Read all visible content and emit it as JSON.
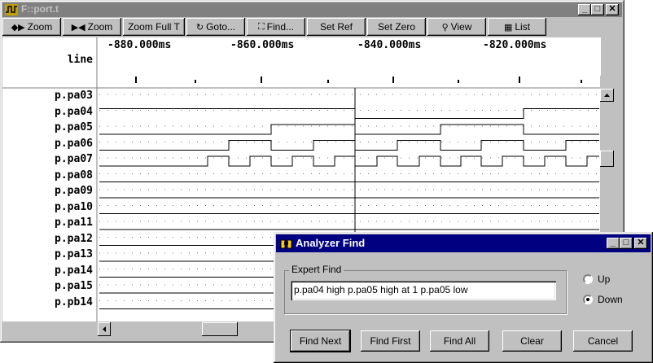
{
  "main_window": {
    "title": "F::port.t",
    "controls": {
      "minimize": "_",
      "maximize": "□",
      "close": "✕"
    }
  },
  "toolbar": [
    {
      "icon": "zoom-in-arrows-icon",
      "glyph": "◆▶",
      "label": "Zoom"
    },
    {
      "icon": "zoom-out-arrows-icon",
      "glyph": "▶◀",
      "label": "Zoom"
    },
    {
      "icon": "",
      "glyph": "",
      "label": "Zoom Full T"
    },
    {
      "icon": "goto-icon",
      "glyph": "↻",
      "label": "Goto..."
    },
    {
      "icon": "binoculars-icon",
      "glyph": "⛶",
      "label": "Find..."
    },
    {
      "icon": "",
      "glyph": "",
      "label": "Set Ref"
    },
    {
      "icon": "",
      "glyph": "",
      "label": "Set Zero"
    },
    {
      "icon": "magnifier-icon",
      "glyph": "⚲",
      "label": "View"
    },
    {
      "icon": "list-icon",
      "glyph": "▦",
      "label": "List"
    }
  ],
  "timeline": {
    "ticks": [
      "-880.000ms",
      "-860.000ms",
      "-840.000ms",
      "-820.000ms"
    ],
    "line_header": "line"
  },
  "signals": [
    "p.pa03",
    "p.pa04",
    "p.pa05",
    "p.pa06",
    "p.pa07",
    "p.pa08",
    "p.pa09",
    "p.pa10",
    "p.pa11",
    "p.pa12",
    "p.pa13",
    "p.pa14",
    "p.pa15",
    "p.pb14"
  ],
  "dialog": {
    "title": "Analyzer Find",
    "group_label": "Expert Find",
    "expression": "p.pa04 high p.pa05 high  at 1 p.pa05 low",
    "direction": {
      "up": "Up",
      "down": "Down",
      "selected": "Down"
    },
    "buttons": {
      "find_next": "Find Next",
      "find_first": "Find First",
      "find_all": "Find All",
      "clear": "Clear",
      "cancel": "Cancel"
    },
    "controls": {
      "minimize": "_",
      "maximize": "□",
      "close": "✕"
    }
  },
  "colors": {
    "title_active": "#000080",
    "title_inactive": "#808080",
    "face": "#c0c0c0",
    "trace": "#000000"
  }
}
